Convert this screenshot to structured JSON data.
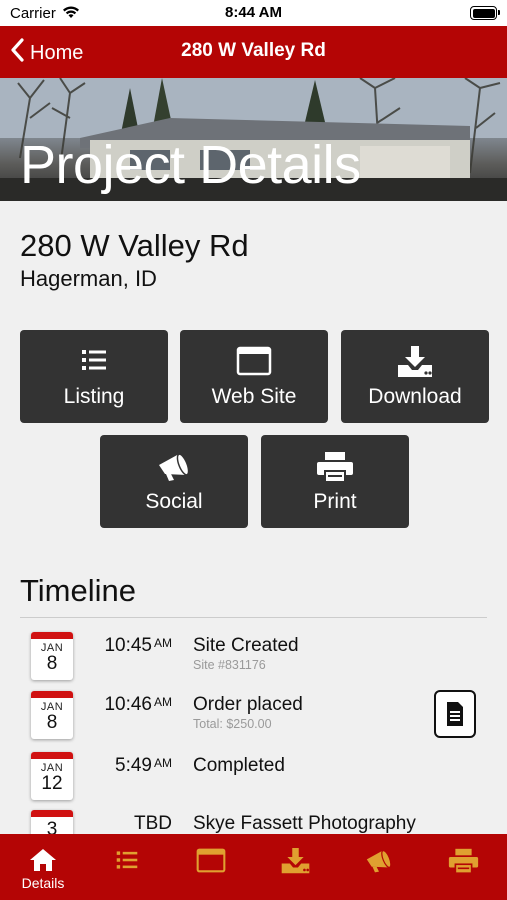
{
  "status_bar": {
    "carrier": "Carrier",
    "time": "8:44 AM"
  },
  "nav": {
    "back_label": "Home",
    "title": "280 W Valley Rd"
  },
  "hero": {
    "title": "Project Details"
  },
  "address": {
    "line1": "280 W Valley Rd",
    "line2": "Hagerman, ID"
  },
  "actions": {
    "listing": "Listing",
    "website": "Web Site",
    "download": "Download",
    "social": "Social",
    "print": "Print"
  },
  "timeline": {
    "heading": "Timeline",
    "events": [
      {
        "month": "JAN",
        "day": "8",
        "time": "10:45",
        "ampm": "AM",
        "title": "Site Created",
        "subtitle": "Site #831176"
      },
      {
        "month": "JAN",
        "day": "8",
        "time": "10:46",
        "ampm": "AM",
        "title": "Order placed",
        "subtitle": "Total: $250.00"
      },
      {
        "month": "JAN",
        "day": "12",
        "time": "5:49",
        "ampm": "AM",
        "title": "Completed",
        "subtitle": ""
      },
      {
        "month": "",
        "day": "3",
        "time": "TBD",
        "ampm": "",
        "title": "Skye Fassett Photography",
        "subtitle": ""
      }
    ]
  },
  "tab_bar": {
    "details_label": "Details",
    "icons": [
      "home-icon",
      "list-icon",
      "browser-icon",
      "download-icon",
      "megaphone-icon",
      "printer-icon"
    ]
  },
  "colors": {
    "brand_red": "#b40505",
    "tile_gray": "#333333",
    "active_tab": "#ffffff",
    "inactive_tab": "#e0a030"
  }
}
